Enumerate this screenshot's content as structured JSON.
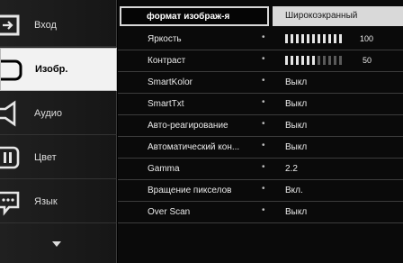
{
  "sidebar": {
    "items": [
      {
        "label": "Вход",
        "icon": "input-icon"
      },
      {
        "label": "Изобр.",
        "icon": "picture-icon",
        "active": true
      },
      {
        "label": "Аудио",
        "icon": "speaker-icon"
      },
      {
        "label": "Цвет",
        "icon": "color-icon"
      },
      {
        "label": "Язык",
        "icon": "language-icon"
      }
    ],
    "more_icon": "chevron-down-icon"
  },
  "header": {
    "label": "формат изображ-я",
    "value": "Широкоэкранный"
  },
  "rows": [
    {
      "name": "Яркость",
      "type": "slider",
      "value": 100
    },
    {
      "name": "Контраст",
      "type": "slider",
      "value": 50
    },
    {
      "name": "SmartKolor",
      "value": "Выкл"
    },
    {
      "name": "SmartTxt",
      "value": "Выкл"
    },
    {
      "name": "Авто-реагирование",
      "value": "Выкл"
    },
    {
      "name": "Автоматический кон...",
      "value": "Выкл"
    },
    {
      "name": "Gamma",
      "value": "2.2"
    },
    {
      "name": "Вращение пикселов",
      "value": "Вкл."
    },
    {
      "name": "Over Scan",
      "value": "Выкл"
    }
  ],
  "dot_glyph": "•",
  "colors": {
    "active_bg": "#f2f2f2",
    "header_value_bg": "#d9d9d9",
    "bar_on": "#e6e6e6",
    "bar_off": "#5a5a5a"
  }
}
